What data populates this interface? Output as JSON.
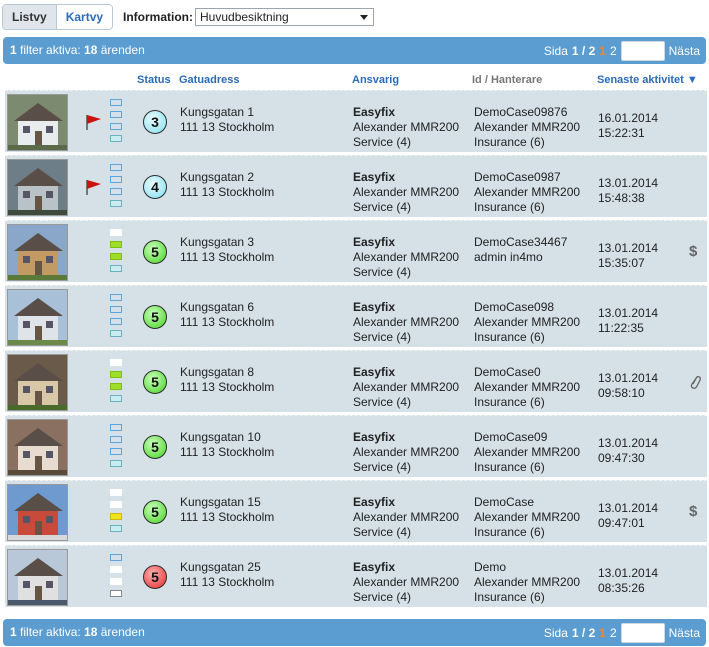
{
  "toolbar": {
    "view_list": "Listvy",
    "view_map": "Kartvy",
    "info_label": "Information:",
    "info_value": "Huvudbesiktning"
  },
  "filter": {
    "count": "1",
    "active_text": " filter aktiva: ",
    "total": "18",
    "cases_text": " ärenden",
    "page_label": "Sida",
    "page_of": "1 / 2",
    "page_cur": "1",
    "page_next_num": "2",
    "next_label": "Nästa"
  },
  "columns": {
    "status": "Status",
    "address": "Gatuadress",
    "responsible": "Ansvarig",
    "id": "Id / Hanterare",
    "latest": "Senaste aktivitet ▼"
  },
  "colors": {
    "filter_bar": "#5b9dd0",
    "row_bg": "#d6e1e7",
    "link": "#2a6bb8",
    "flag_red": "#cc1111"
  },
  "rows": [
    {
      "street": "Kungsgatan 1",
      "zip": "111 13 Stockholm",
      "status": "3",
      "company": "Easyfix",
      "person": "Alexander MMR200",
      "service": "Service (4)",
      "case": "DemoCase09876",
      "handler": "Alexander MMR200",
      "insurance": "Insurance (6)",
      "date": "16.01.2014",
      "time": "15:22:31",
      "flag": true,
      "icon": ""
    },
    {
      "street": "Kungsgatan 2",
      "zip": "111 13 Stockholm",
      "status": "4",
      "company": "Easyfix",
      "person": "Alexander MMR200",
      "service": "Service (4)",
      "case": "DemoCase0987",
      "handler": "Alexander MMR200",
      "insurance": "Insurance (6)",
      "date": "13.01.2014",
      "time": "15:48:38",
      "flag": true,
      "icon": ""
    },
    {
      "street": "Kungsgatan 3",
      "zip": "111 13 Stockholm",
      "status": "5",
      "company": "Easyfix",
      "person": "Alexander MMR200",
      "service": "Service (4)",
      "case": "DemoCase34467",
      "handler": "admin in4mo",
      "insurance": "",
      "date": "13.01.2014",
      "time": "15:35:07",
      "flag": false,
      "icon": "$"
    },
    {
      "street": "Kungsgatan 6",
      "zip": "111 13 Stockholm",
      "status": "5",
      "company": "Easyfix",
      "person": "Alexander MMR200",
      "service": "Service (4)",
      "case": "DemoCase098",
      "handler": "Alexander MMR200",
      "insurance": "Insurance (6)",
      "date": "13.01.2014",
      "time": "11:22:35",
      "flag": false,
      "icon": ""
    },
    {
      "street": "Kungsgatan 8",
      "zip": "111 13 Stockholm",
      "status": "5",
      "company": "Easyfix",
      "person": "Alexander MMR200",
      "service": "Service (4)",
      "case": "DemoCase0",
      "handler": "Alexander MMR200",
      "insurance": "Insurance (6)",
      "date": "13.01.2014",
      "time": "09:58:10",
      "flag": false,
      "icon": "clip"
    },
    {
      "street": "Kungsgatan 10",
      "zip": "111 13 Stockholm",
      "status": "5",
      "company": "Easyfix",
      "person": "Alexander MMR200",
      "service": "Service (4)",
      "case": "DemoCase09",
      "handler": "Alexander MMR200",
      "insurance": "Insurance (6)",
      "date": "13.01.2014",
      "time": "09:47:30",
      "flag": false,
      "icon": ""
    },
    {
      "street": "Kungsgatan 15",
      "zip": "111 13 Stockholm",
      "status": "5",
      "company": "Easyfix",
      "person": "Alexander MMR200",
      "service": "Service (4)",
      "case": "DemoCase",
      "handler": "Alexander MMR200",
      "insurance": "Insurance (6)",
      "date": "13.01.2014",
      "time": "09:47:01",
      "flag": false,
      "icon": "$"
    },
    {
      "street": "Kungsgatan 25",
      "zip": "111 13 Stockholm",
      "status": "5",
      "company": "Easyfix",
      "person": "Alexander MMR200",
      "service": "Service (4)",
      "case": "Demo",
      "handler": "Alexander MMR200",
      "insurance": "Insurance (6)",
      "date": "13.01.2014",
      "time": "08:35:26",
      "flag": false,
      "icon": ""
    }
  ]
}
